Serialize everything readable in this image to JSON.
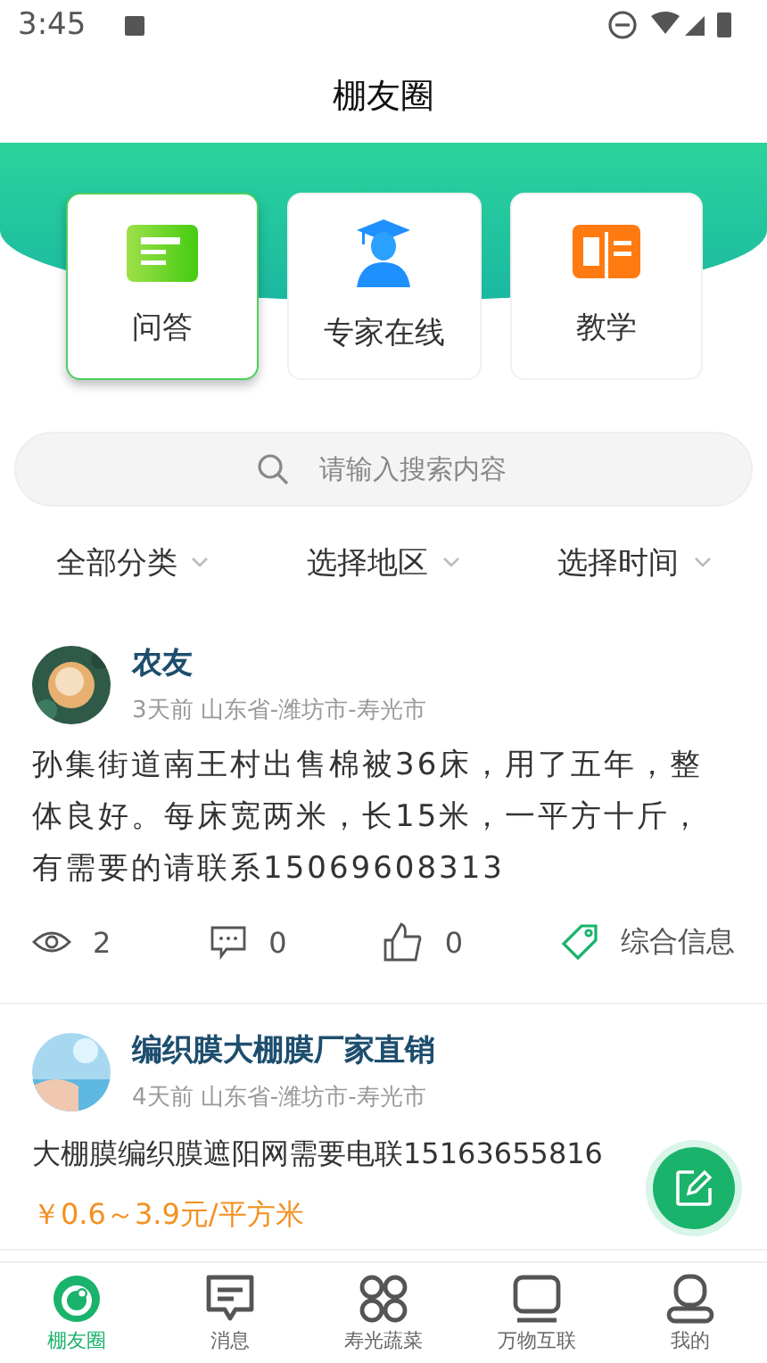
{
  "status_bar": {
    "time": "3:45"
  },
  "title": "棚友圈",
  "categories": [
    {
      "label": "问答",
      "kind": "qa",
      "selected": true
    },
    {
      "label": "专家在线",
      "kind": "expert",
      "selected": false
    },
    {
      "label": "教学",
      "kind": "teach",
      "selected": false
    }
  ],
  "search": {
    "placeholder": "请输入搜索内容"
  },
  "filters": [
    "全部分类",
    "选择地区",
    "选择时间"
  ],
  "posts": [
    {
      "author": "农友",
      "meta": "3天前 山东省-潍坊市-寿光市",
      "body": "孙集街道南王村出售棉被36床，用了五年，整体良好。每床宽两米，长15米，一平方十斤，有需要的请联系15069608313",
      "views": "2",
      "comments": "0",
      "likes": "0",
      "tag": "综合信息"
    },
    {
      "author": "编织膜大棚膜厂家直销",
      "meta": "4天前 山东省-潍坊市-寿光市",
      "body": "大棚膜编织膜遮阳网需要电联15163655816",
      "price": "￥0.6～3.9元/平方米"
    }
  ],
  "nav": [
    {
      "label": "棚友圈",
      "kind": "circle",
      "selected": true
    },
    {
      "label": "消息",
      "kind": "message",
      "selected": false
    },
    {
      "label": "寿光蔬菜",
      "kind": "grid",
      "selected": false
    },
    {
      "label": "万物互联",
      "kind": "screen",
      "selected": false
    },
    {
      "label": "我的",
      "kind": "user",
      "selected": false
    }
  ]
}
